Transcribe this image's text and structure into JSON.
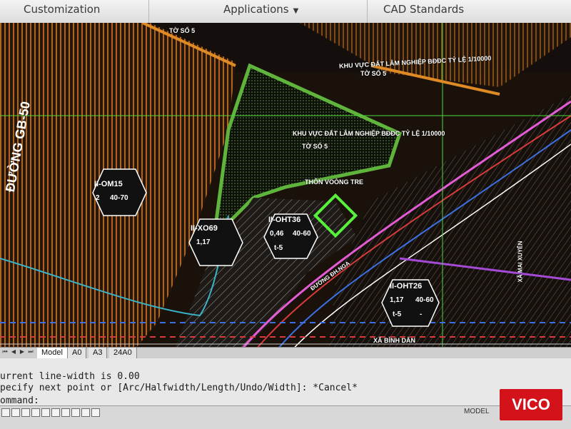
{
  "ribbon": {
    "tabs": [
      {
        "label": "Customization"
      },
      {
        "label": "Applications",
        "icon": "chevron-down-icon"
      },
      {
        "label": "CAD Standards"
      }
    ]
  },
  "map": {
    "title_top": "TỜ SỐ 5",
    "forest_area_top": "KHU VỰC ĐẤT LÂM NGHIỆP BĐĐC TỶ LỆ 1/10000",
    "sheet_top_right": "TỜ SỐ 5",
    "forest_area_center": "KHU VỰC ĐẤT LÂM NGHIỆP BĐĐC TỶ LỆ 1/10000",
    "sheet_center": "TỜ SỐ 5",
    "village": "THÔN VOÒNG TRE",
    "road_left": "ĐƯỜNG GB-50",
    "road_bottom": "ĐƯỜNG ĐH.NGA",
    "commune": "XÃ BÌNH DÂN",
    "commune_right": "XÃ MAI XUYÊN",
    "zones": [
      {
        "code": "II-OM15",
        "cells": [
          "2",
          "40-70"
        ]
      },
      {
        "code": "II-XO69",
        "cells": [
          "1,17",
          "",
          ""
        ]
      },
      {
        "code": "II-OHT36",
        "cells": [
          "0,46",
          "40-60",
          "t-5"
        ]
      },
      {
        "code": "II-OHT26",
        "cells": [
          "1,17",
          "40-60",
          "t-5",
          "-"
        ]
      }
    ]
  },
  "layout_tabs": [
    {
      "label": "Model"
    },
    {
      "label": "A0"
    },
    {
      "label": "A3"
    },
    {
      "label": "24A0"
    }
  ],
  "command_line": {
    "history": [
      "urrent line-width is 0.00",
      "pecify next point or [Arc/Halfwidth/Length/Undo/Width]: *Cancel*"
    ],
    "prompt": "ommand:"
  },
  "status": {
    "model_label": "MODEL",
    "logo": "VICO"
  }
}
